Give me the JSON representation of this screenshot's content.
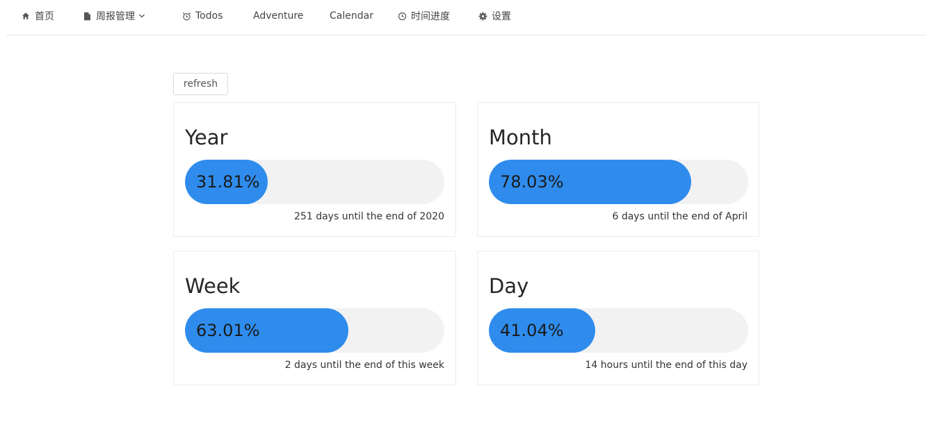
{
  "nav": {
    "items": [
      {
        "label": "首页",
        "icon": "home-icon"
      },
      {
        "label": "周报管理",
        "icon": "file-icon",
        "dropdown": true
      },
      {
        "label": "Todos",
        "icon": "alarm-clock-icon"
      },
      {
        "label": "Adventure"
      },
      {
        "label": "Calendar"
      },
      {
        "label": "时间进度",
        "icon": "clock-icon"
      },
      {
        "label": "设置",
        "icon": "gear-icon"
      }
    ]
  },
  "toolbar": {
    "refresh_label": "refresh"
  },
  "colors": {
    "accent": "#2f8ced",
    "track": "#f2f2f2"
  },
  "progress": {
    "year": {
      "title": "Year",
      "percent": 31.81,
      "percent_label": "31.81%",
      "remaining": "251 days until the end of 2020"
    },
    "month": {
      "title": "Month",
      "percent": 78.03,
      "percent_label": "78.03%",
      "remaining": "6 days until the end of April"
    },
    "week": {
      "title": "Week",
      "percent": 63.01,
      "percent_label": "63.01%",
      "remaining": "2 days until the end of this week"
    },
    "day": {
      "title": "Day",
      "percent": 41.04,
      "percent_label": "41.04%",
      "remaining": "14 hours until the end of this day"
    }
  }
}
